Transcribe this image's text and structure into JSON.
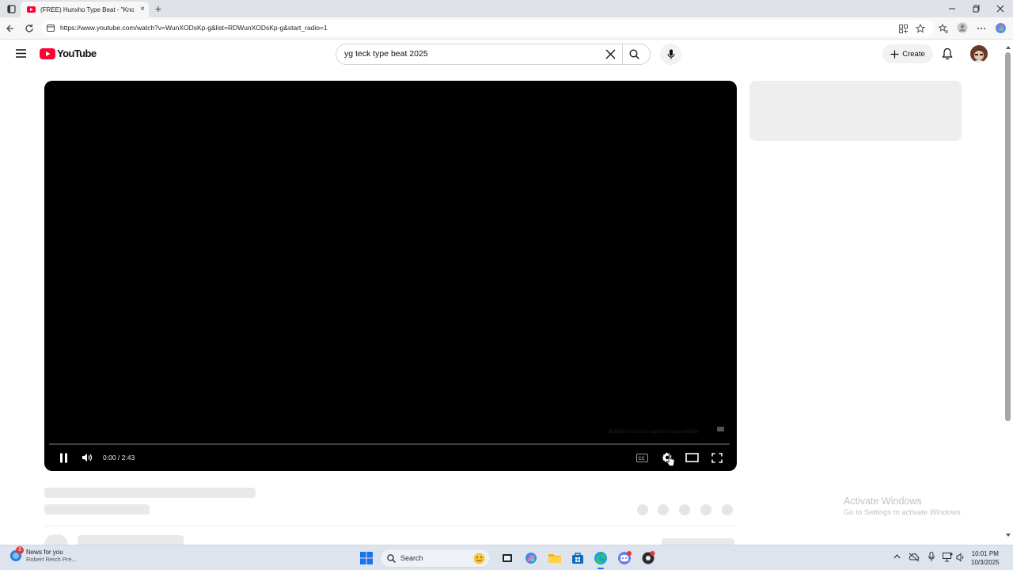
{
  "browser": {
    "tab_title": "(FREE) Hunxho Type Beat - \"Knowi",
    "url": "https://www.youtube.com/watch?v=WunXODsKp-g&list=RDWunXODsKp-g&start_radio=1",
    "new_tab_symbol": "+",
    "tab_close_symbol": "×",
    "page_load_progress": 0.37
  },
  "youtube": {
    "logo_text": "YouTube",
    "search_query": "yg teck type beat 2025",
    "create_label": "Create"
  },
  "player": {
    "time_display": "0:00 / 2:43",
    "captions_message": "Subtitles/closed captions unavailable",
    "progress_fraction": 0.0
  },
  "watermark": {
    "title": "Activate Windows",
    "subtitle": "Go to Settings to activate Windows."
  },
  "taskbar": {
    "news_badge": "3",
    "news_title": "News for you",
    "news_subtitle": "Robert Reich Pre...",
    "search_label": "Search",
    "time": "10:01 PM",
    "date": "10/3/2025"
  },
  "colors": {
    "youtube_red": "#ff0033",
    "load_progress": "#c63e8f",
    "placeholder_gray": "#e9e9e9"
  }
}
